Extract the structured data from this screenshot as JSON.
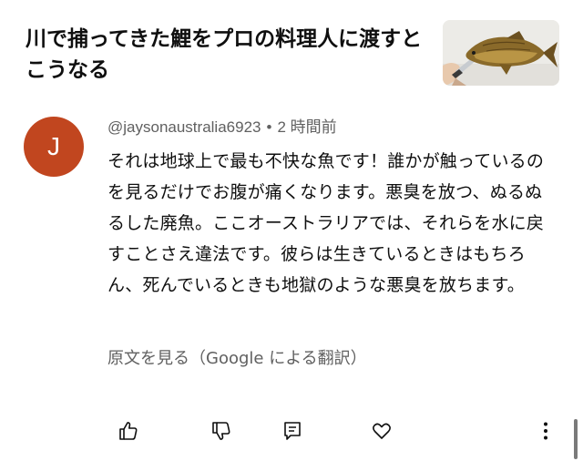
{
  "video": {
    "title": "川で捕ってきた鯉をプロの料理人に渡すとこうなる",
    "thumbnail_icon": "carp-fish-thumbnail"
  },
  "comment": {
    "avatar_initial": "J",
    "avatar_color": "#c1461f",
    "author": "@jaysonaustralia6923",
    "separator": "•",
    "timestamp": "2 時間前",
    "text": "それは地球上で最も不快な魚です！誰かが触っているのを見るだけでお腹が痛くなります。悪臭を放つ、ぬるぬるした廃魚。ここオーストラリアでは、それらを水に戻すことさえ違法です。彼らは生きているときはもちろん、死んでいるときも地獄のような悪臭を放ちます。",
    "translation_link": "原文を見る（Google による翻訳）"
  },
  "actions": {
    "like_icon": "thumbs-up-icon",
    "dislike_icon": "thumbs-down-icon",
    "reply_icon": "comment-reply-icon",
    "heart_icon": "heart-icon",
    "more_icon": "more-vertical-icon"
  }
}
